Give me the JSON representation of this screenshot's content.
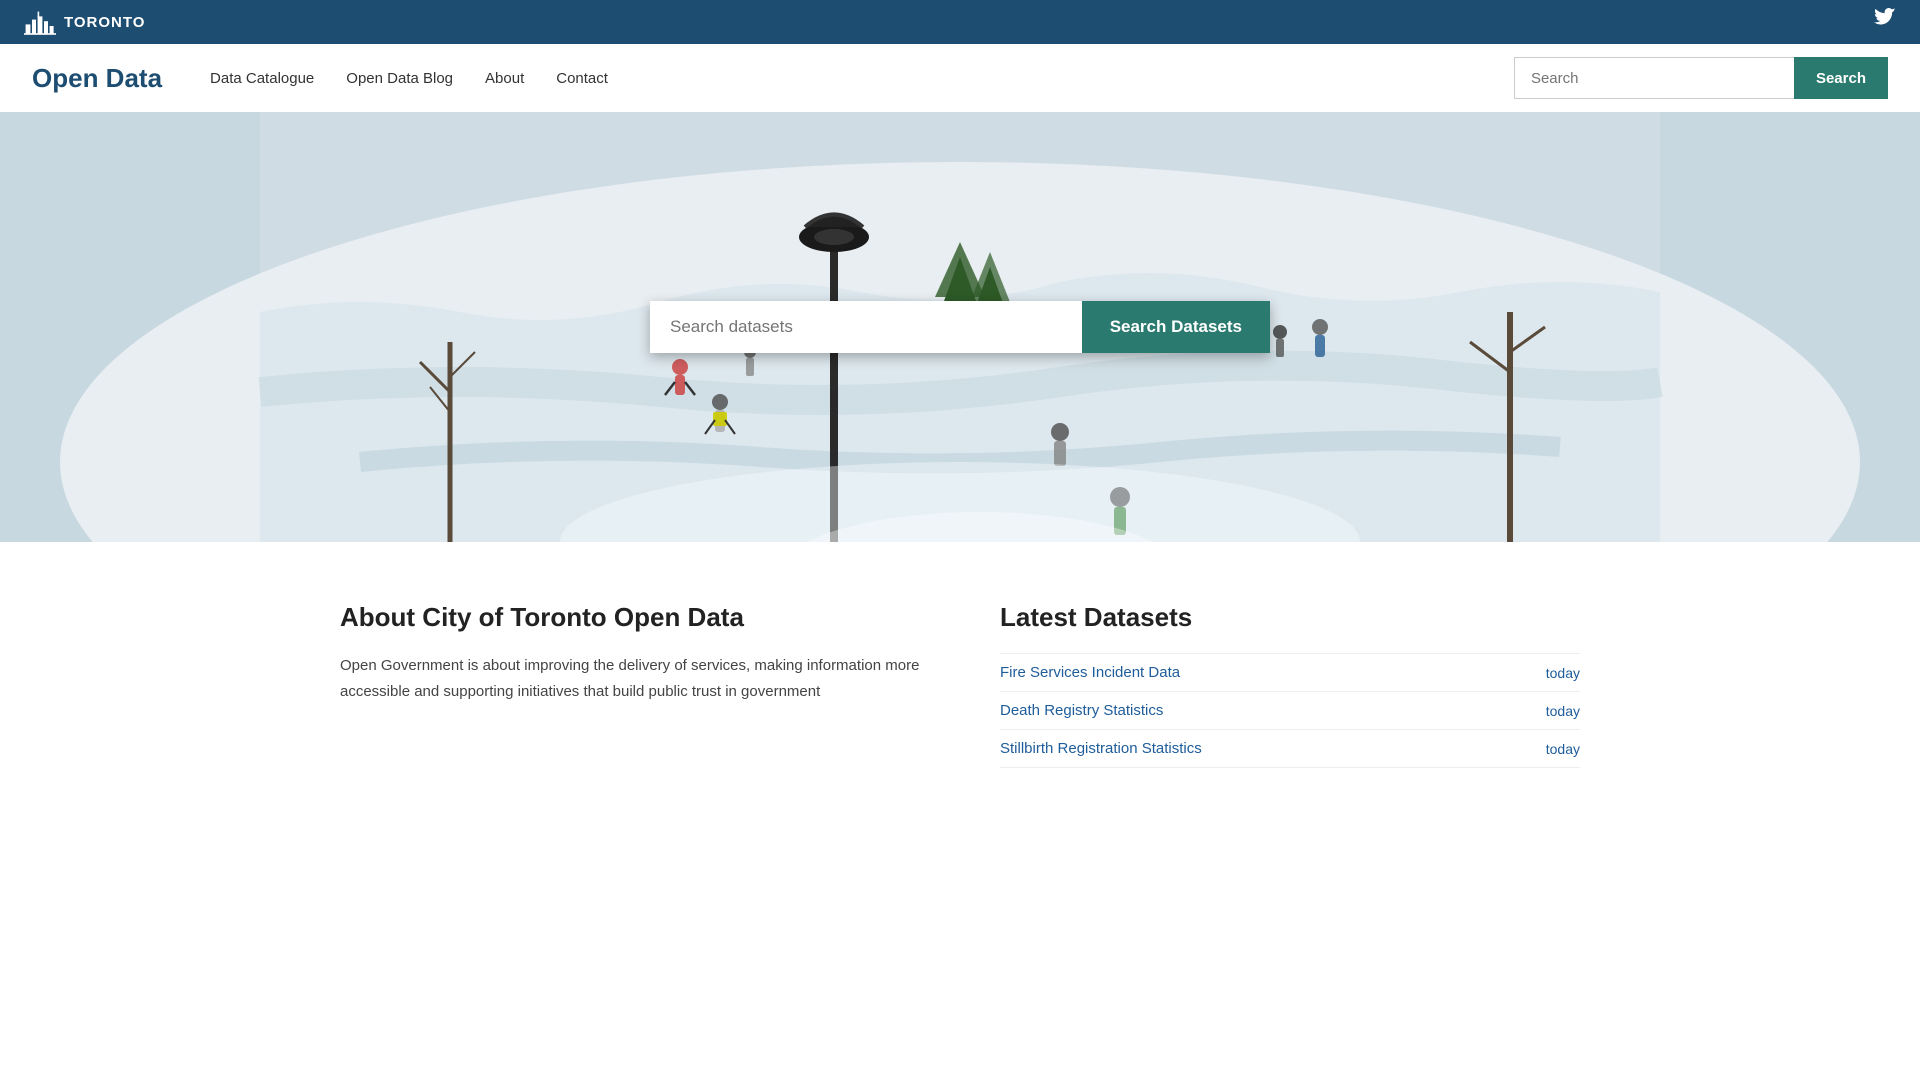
{
  "topBar": {
    "logoText": "TORONTO",
    "twitterAriaLabel": "Twitter"
  },
  "nav": {
    "siteTitle": "Open Data",
    "links": [
      {
        "label": "Data Catalogue",
        "href": "#"
      },
      {
        "label": "Open Data Blog",
        "href": "#"
      },
      {
        "label": "About",
        "href": "#"
      },
      {
        "label": "Contact",
        "href": "#"
      }
    ],
    "searchPlaceholder": "Search",
    "searchButtonLabel": "Search"
  },
  "hero": {
    "searchPlaceholder": "Search datasets",
    "searchButtonLabel": "Search Datasets"
  },
  "about": {
    "heading": "About City of Toronto Open Data",
    "body": "Open Government is about improving the delivery of services, making information more accessible and supporting initiatives that build public trust in government"
  },
  "latestDatasets": {
    "heading": "Latest Datasets",
    "items": [
      {
        "label": "Fire Services Incident Data",
        "date": "today",
        "href": "#"
      },
      {
        "label": "Death Registry Statistics",
        "date": "today",
        "href": "#"
      },
      {
        "label": "Stillbirth Registration Statistics",
        "date": "today",
        "href": "#"
      }
    ]
  }
}
